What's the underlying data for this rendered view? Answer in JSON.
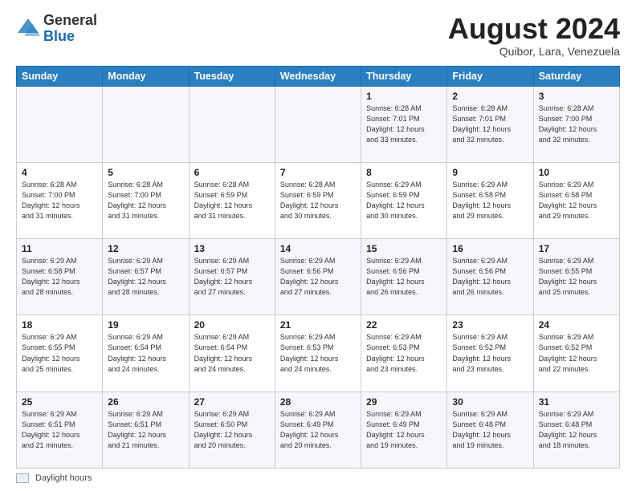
{
  "header": {
    "logo_general": "General",
    "logo_blue": "Blue",
    "month_title": "August 2024",
    "location": "Quibor, Lara, Venezuela"
  },
  "weekdays": [
    "Sunday",
    "Monday",
    "Tuesday",
    "Wednesday",
    "Thursday",
    "Friday",
    "Saturday"
  ],
  "weeks": [
    [
      {
        "day": "",
        "info": ""
      },
      {
        "day": "",
        "info": ""
      },
      {
        "day": "",
        "info": ""
      },
      {
        "day": "",
        "info": ""
      },
      {
        "day": "1",
        "info": "Sunrise: 6:28 AM\nSunset: 7:01 PM\nDaylight: 12 hours\nand 33 minutes."
      },
      {
        "day": "2",
        "info": "Sunrise: 6:28 AM\nSunset: 7:01 PM\nDaylight: 12 hours\nand 32 minutes."
      },
      {
        "day": "3",
        "info": "Sunrise: 6:28 AM\nSunset: 7:00 PM\nDaylight: 12 hours\nand 32 minutes."
      }
    ],
    [
      {
        "day": "4",
        "info": "Sunrise: 6:28 AM\nSunset: 7:00 PM\nDaylight: 12 hours\nand 31 minutes."
      },
      {
        "day": "5",
        "info": "Sunrise: 6:28 AM\nSunset: 7:00 PM\nDaylight: 12 hours\nand 31 minutes."
      },
      {
        "day": "6",
        "info": "Sunrise: 6:28 AM\nSunset: 6:59 PM\nDaylight: 12 hours\nand 31 minutes."
      },
      {
        "day": "7",
        "info": "Sunrise: 6:28 AM\nSunset: 6:59 PM\nDaylight: 12 hours\nand 30 minutes."
      },
      {
        "day": "8",
        "info": "Sunrise: 6:29 AM\nSunset: 6:59 PM\nDaylight: 12 hours\nand 30 minutes."
      },
      {
        "day": "9",
        "info": "Sunrise: 6:29 AM\nSunset: 6:58 PM\nDaylight: 12 hours\nand 29 minutes."
      },
      {
        "day": "10",
        "info": "Sunrise: 6:29 AM\nSunset: 6:58 PM\nDaylight: 12 hours\nand 29 minutes."
      }
    ],
    [
      {
        "day": "11",
        "info": "Sunrise: 6:29 AM\nSunset: 6:58 PM\nDaylight: 12 hours\nand 28 minutes."
      },
      {
        "day": "12",
        "info": "Sunrise: 6:29 AM\nSunset: 6:57 PM\nDaylight: 12 hours\nand 28 minutes."
      },
      {
        "day": "13",
        "info": "Sunrise: 6:29 AM\nSunset: 6:57 PM\nDaylight: 12 hours\nand 27 minutes."
      },
      {
        "day": "14",
        "info": "Sunrise: 6:29 AM\nSunset: 6:56 PM\nDaylight: 12 hours\nand 27 minutes."
      },
      {
        "day": "15",
        "info": "Sunrise: 6:29 AM\nSunset: 6:56 PM\nDaylight: 12 hours\nand 26 minutes."
      },
      {
        "day": "16",
        "info": "Sunrise: 6:29 AM\nSunset: 6:56 PM\nDaylight: 12 hours\nand 26 minutes."
      },
      {
        "day": "17",
        "info": "Sunrise: 6:29 AM\nSunset: 6:55 PM\nDaylight: 12 hours\nand 25 minutes."
      }
    ],
    [
      {
        "day": "18",
        "info": "Sunrise: 6:29 AM\nSunset: 6:55 PM\nDaylight: 12 hours\nand 25 minutes."
      },
      {
        "day": "19",
        "info": "Sunrise: 6:29 AM\nSunset: 6:54 PM\nDaylight: 12 hours\nand 24 minutes."
      },
      {
        "day": "20",
        "info": "Sunrise: 6:29 AM\nSunset: 6:54 PM\nDaylight: 12 hours\nand 24 minutes."
      },
      {
        "day": "21",
        "info": "Sunrise: 6:29 AM\nSunset: 6:53 PM\nDaylight: 12 hours\nand 24 minutes."
      },
      {
        "day": "22",
        "info": "Sunrise: 6:29 AM\nSunset: 6:53 PM\nDaylight: 12 hours\nand 23 minutes."
      },
      {
        "day": "23",
        "info": "Sunrise: 6:29 AM\nSunset: 6:52 PM\nDaylight: 12 hours\nand 23 minutes."
      },
      {
        "day": "24",
        "info": "Sunrise: 6:29 AM\nSunset: 6:52 PM\nDaylight: 12 hours\nand 22 minutes."
      }
    ],
    [
      {
        "day": "25",
        "info": "Sunrise: 6:29 AM\nSunset: 6:51 PM\nDaylight: 12 hours\nand 21 minutes."
      },
      {
        "day": "26",
        "info": "Sunrise: 6:29 AM\nSunset: 6:51 PM\nDaylight: 12 hours\nand 21 minutes."
      },
      {
        "day": "27",
        "info": "Sunrise: 6:29 AM\nSunset: 6:50 PM\nDaylight: 12 hours\nand 20 minutes."
      },
      {
        "day": "28",
        "info": "Sunrise: 6:29 AM\nSunset: 6:49 PM\nDaylight: 12 hours\nand 20 minutes."
      },
      {
        "day": "29",
        "info": "Sunrise: 6:29 AM\nSunset: 6:49 PM\nDaylight: 12 hours\nand 19 minutes."
      },
      {
        "day": "30",
        "info": "Sunrise: 6:29 AM\nSunset: 6:48 PM\nDaylight: 12 hours\nand 19 minutes."
      },
      {
        "day": "31",
        "info": "Sunrise: 6:29 AM\nSunset: 6:48 PM\nDaylight: 12 hours\nand 18 minutes."
      }
    ]
  ],
  "footer": {
    "legend_label": "Daylight hours"
  }
}
